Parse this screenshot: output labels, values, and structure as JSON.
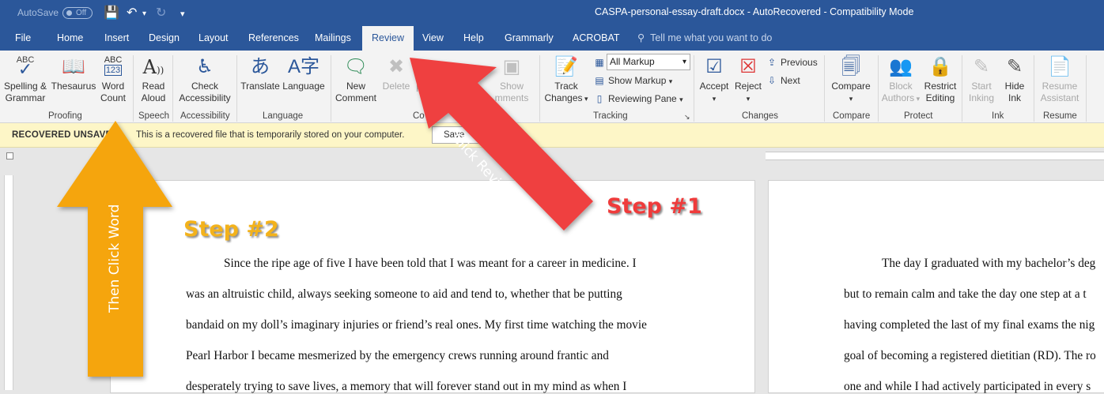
{
  "titlebar": {
    "autosave_label": "AutoSave",
    "autosave_state": "Off",
    "title": "CASPA-personal-essay-draft.docx - AutoRecovered - Compatibility Mode"
  },
  "tabs": [
    "File",
    "Home",
    "Insert",
    "Design",
    "Layout",
    "References",
    "Mailings",
    "Review",
    "View",
    "Help",
    "Grammarly",
    "ACROBAT"
  ],
  "active_tab": "Review",
  "tell_me": "Tell me what you want to do",
  "ribbon": {
    "proofing": {
      "label": "Proofing",
      "spelling": [
        "Spelling &",
        "Grammar"
      ],
      "thesaurus": "Thesaurus",
      "word_count": [
        "Word",
        "Count"
      ]
    },
    "speech": {
      "label": "Speech",
      "read_aloud": [
        "Read",
        "Aloud"
      ]
    },
    "accessibility": {
      "label": "Accessibility",
      "check": [
        "Check",
        "Accessibility"
      ]
    },
    "language": {
      "label": "Language",
      "translate": "Translate",
      "language": "Language"
    },
    "comments": {
      "label_partial": "Co",
      "new_comment": [
        "New",
        "Comment"
      ],
      "delete": "Delete",
      "previous_partial": "P",
      "show_comments": [
        "Show",
        "mments"
      ]
    },
    "tracking": {
      "label": "Tracking",
      "track_changes": [
        "Track",
        "Changes"
      ],
      "markup_value": "All Markup",
      "show_markup": "Show Markup",
      "reviewing_pane": "Reviewing Pane"
    },
    "changes": {
      "label": "Changes",
      "accept": "Accept",
      "reject": "Reject",
      "previous": "Previous",
      "next": "Next"
    },
    "compare": {
      "label": "Compare",
      "compare": "Compare"
    },
    "protect": {
      "label": "Protect",
      "block_authors": [
        "Block",
        "Authors"
      ],
      "restrict_editing": [
        "Restrict",
        "Editing"
      ]
    },
    "ink": {
      "label": "Ink",
      "start_inking": [
        "Start",
        "Inking"
      ],
      "hide_ink": [
        "Hide",
        "Ink"
      ]
    },
    "resume": {
      "label": "Resume",
      "resume_assistant": [
        "Resume",
        "Assistant"
      ]
    }
  },
  "infobar": {
    "label": "RECOVERED UNSAVED",
    "message": "This is a recovered file that is temporarily stored on your computer.",
    "save_button": "Save"
  },
  "document": {
    "page1_lines": [
      "Since the ripe age of five I have been told that I was meant for a career in medicine. I",
      "was an altruistic child, always seeking someone to aid and tend to, whether that be putting",
      "bandaid on my doll’s imaginary injuries or friend’s real ones. My first time watching the movie",
      "Pearl Harbor I became mesmerized by the emergency crews running around frantic and",
      "desperately trying to save lives, a memory that will forever stand out in my mind as when I"
    ],
    "page2_lines": [
      "The day I graduated with my bachelor’s deg",
      "but to remain calm and take the day one step at a t",
      "having completed the last of my final exams the nig",
      "goal of becoming a registered dietitian (RD). The ro",
      "one and while I had actively participated in every s"
    ]
  },
  "annotations": {
    "step1": "Step #1",
    "step2": "Step #2",
    "arrow1_text": "Click Review",
    "arrow2_text": "Then Click Word",
    "arrow1_color": "#ef4040",
    "arrow2_color": "#f5a50f"
  }
}
